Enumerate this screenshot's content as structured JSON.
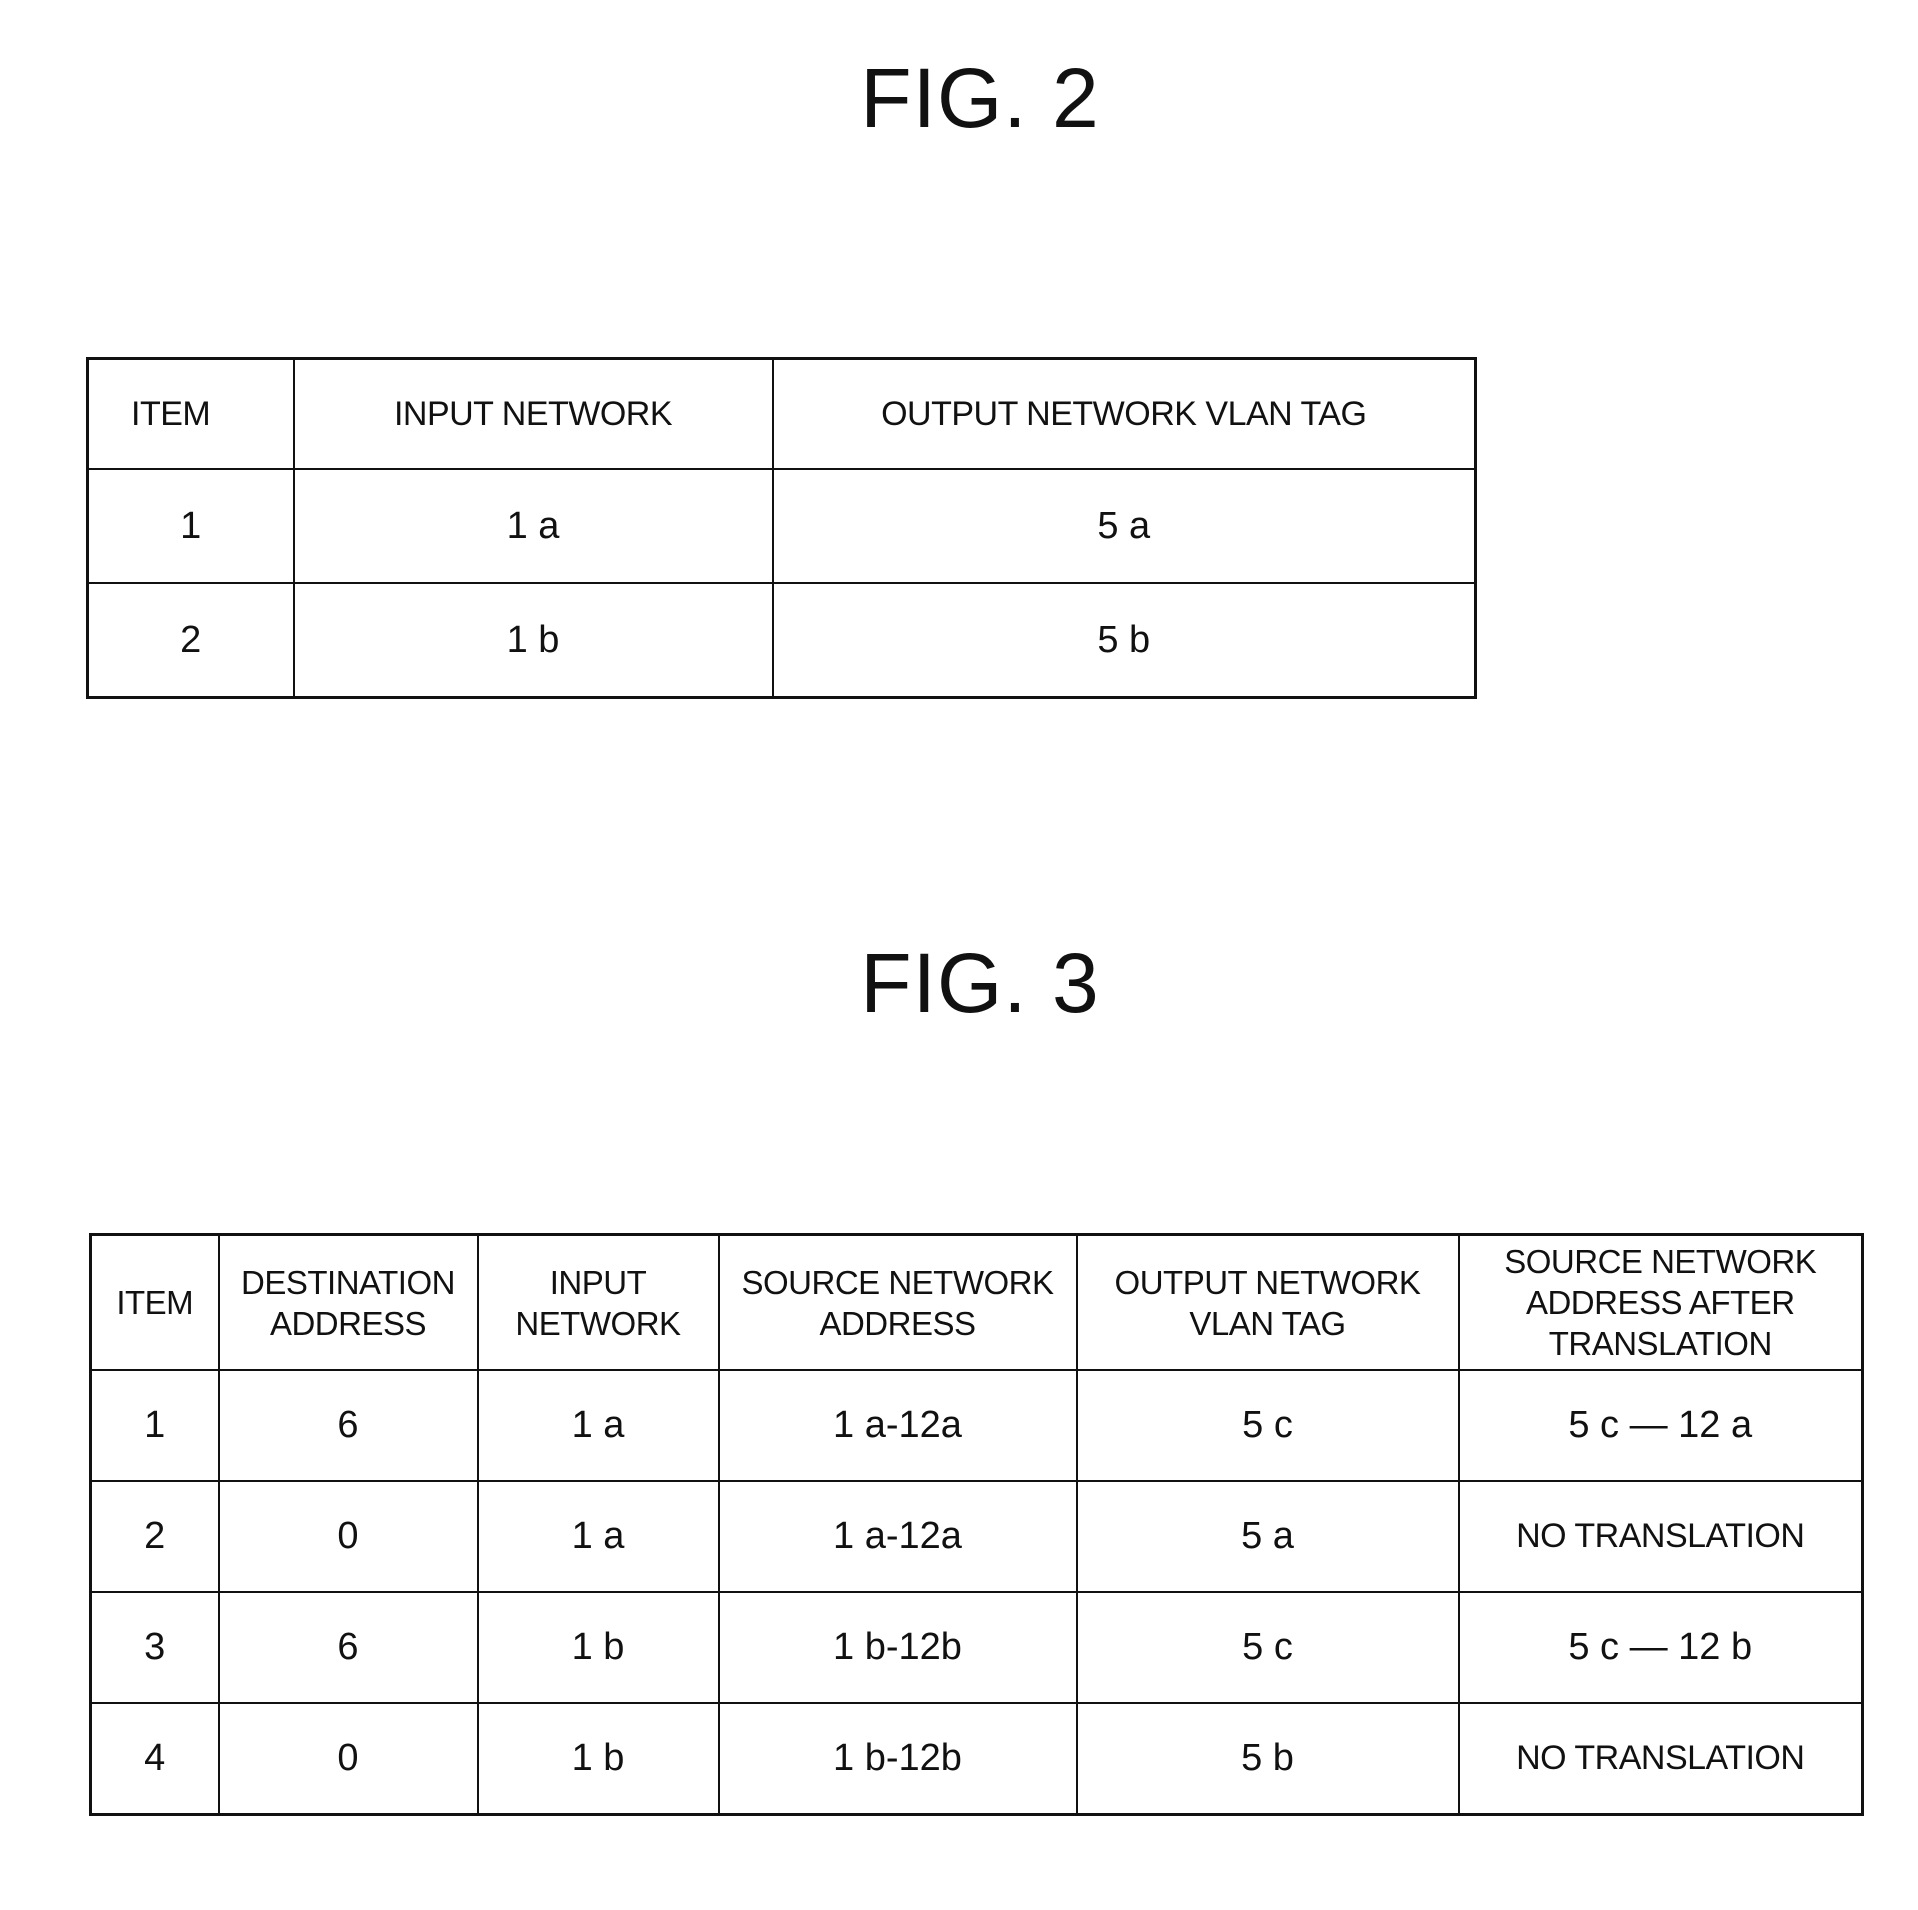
{
  "fig2": {
    "title": "FIG. 2",
    "headers": [
      "ITEM",
      "INPUT NETWORK",
      "OUTPUT NETWORK VLAN TAG"
    ],
    "rows": [
      [
        "1",
        "1 a",
        "5 a"
      ],
      [
        "2",
        "1 b",
        "5 b"
      ]
    ]
  },
  "fig3": {
    "title": "FIG. 3",
    "headers": [
      "ITEM",
      "DESTINATION\nADDRESS",
      "INPUT\nNETWORK",
      "SOURCE NETWORK\nADDRESS",
      "OUTPUT NETWORK\nVLAN TAG",
      "SOURCE NETWORK\nADDRESS AFTER\nTRANSLATION"
    ],
    "rows": [
      [
        "1",
        "6",
        "1 a",
        "1 a-12a",
        "5 c",
        "5 c — 12 a"
      ],
      [
        "2",
        "0",
        "1 a",
        "1 a-12a",
        "5 a",
        "NO TRANSLATION"
      ],
      [
        "3",
        "6",
        "1 b",
        "1 b-12b",
        "5 c",
        "5 c — 12 b"
      ],
      [
        "4",
        "0",
        "1 b",
        "1 b-12b",
        "5 b",
        "NO TRANSLATION"
      ]
    ]
  }
}
